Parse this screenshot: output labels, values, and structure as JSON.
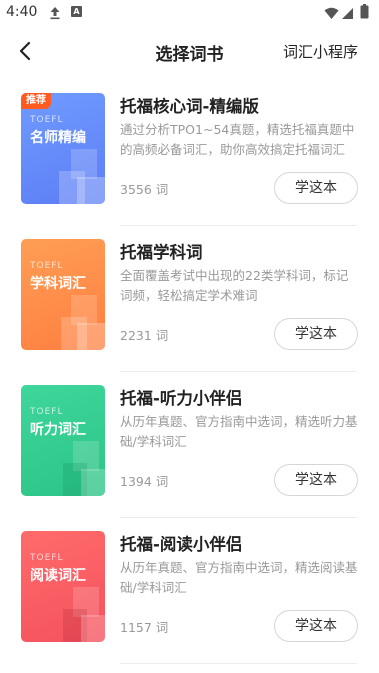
{
  "status_bar": {
    "time": "4:40",
    "icons": [
      "upload-icon",
      "a-notification-icon",
      "wifi-icon",
      "signal-icon",
      "battery-icon"
    ]
  },
  "nav": {
    "back_icon": "chevron-left-icon",
    "title": "选择词书",
    "right_link": "词汇小程序"
  },
  "books": [
    {
      "cover_label": "TOEFL",
      "cover_name": "名师精编",
      "badge": "推荐",
      "title": "托福核心词-精编版",
      "description": "通过分析TPO1~54真题，精选托福真题中的高频必备词汇，助你高效搞定托福词汇",
      "count": "3556 词",
      "button": "学这本",
      "color": "#6589fa"
    },
    {
      "cover_label": "TOEFL",
      "cover_name": "学科词汇",
      "title": "托福学科词",
      "description": "全面覆盖考试中出现的22类学科词，标记词频，轻松搞定学术难词",
      "count": "2231 词",
      "button": "学这本",
      "color": "#ff8f4b"
    },
    {
      "cover_label": "TOEFL",
      "cover_name": "听力词汇",
      "title": "托福-听力小伴侣",
      "description": "从历年真题、官方指南中选词，精选听力基础/学科词汇",
      "count": "1394 词",
      "button": "学这本",
      "color": "#36cd91"
    },
    {
      "cover_label": "TOEFL",
      "cover_name": "阅读词汇",
      "title": "托福-阅读小伴侣",
      "description": "从历年真题、官方指南中选词，精选阅读基础/学科词汇",
      "count": "1157 词",
      "button": "学这本",
      "color": "#f95e63"
    }
  ]
}
